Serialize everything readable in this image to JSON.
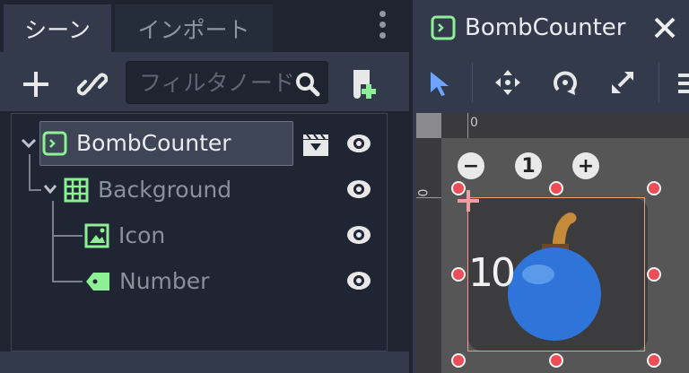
{
  "scene_dock": {
    "tabs": [
      {
        "label": "シーン",
        "active": true
      },
      {
        "label": "インポート",
        "active": false
      }
    ],
    "filter_placeholder": "フィルタノード",
    "tree": [
      {
        "label": "BombCounter",
        "icon": "control-node-icon",
        "selected": true,
        "has_script_icon": true
      },
      {
        "label": "Background",
        "icon": "grid-container-icon"
      },
      {
        "label": "Icon",
        "icon": "texture-rect-icon"
      },
      {
        "label": "Number",
        "icon": "label-node-icon"
      }
    ]
  },
  "editor": {
    "tab_title": "BombCounter",
    "ruler_top_zero": "0",
    "ruler_left_zero": "0",
    "zoom_out": "−",
    "zoom_reset": "1",
    "zoom_in": "+",
    "counter_number": "10"
  },
  "colors": {
    "accent_green": "#8eef97",
    "selection_rect": "#e8a086",
    "handle": "#ee4d58",
    "bomb_blue": "#2f74d8",
    "select_tool": "#6da4ff"
  }
}
